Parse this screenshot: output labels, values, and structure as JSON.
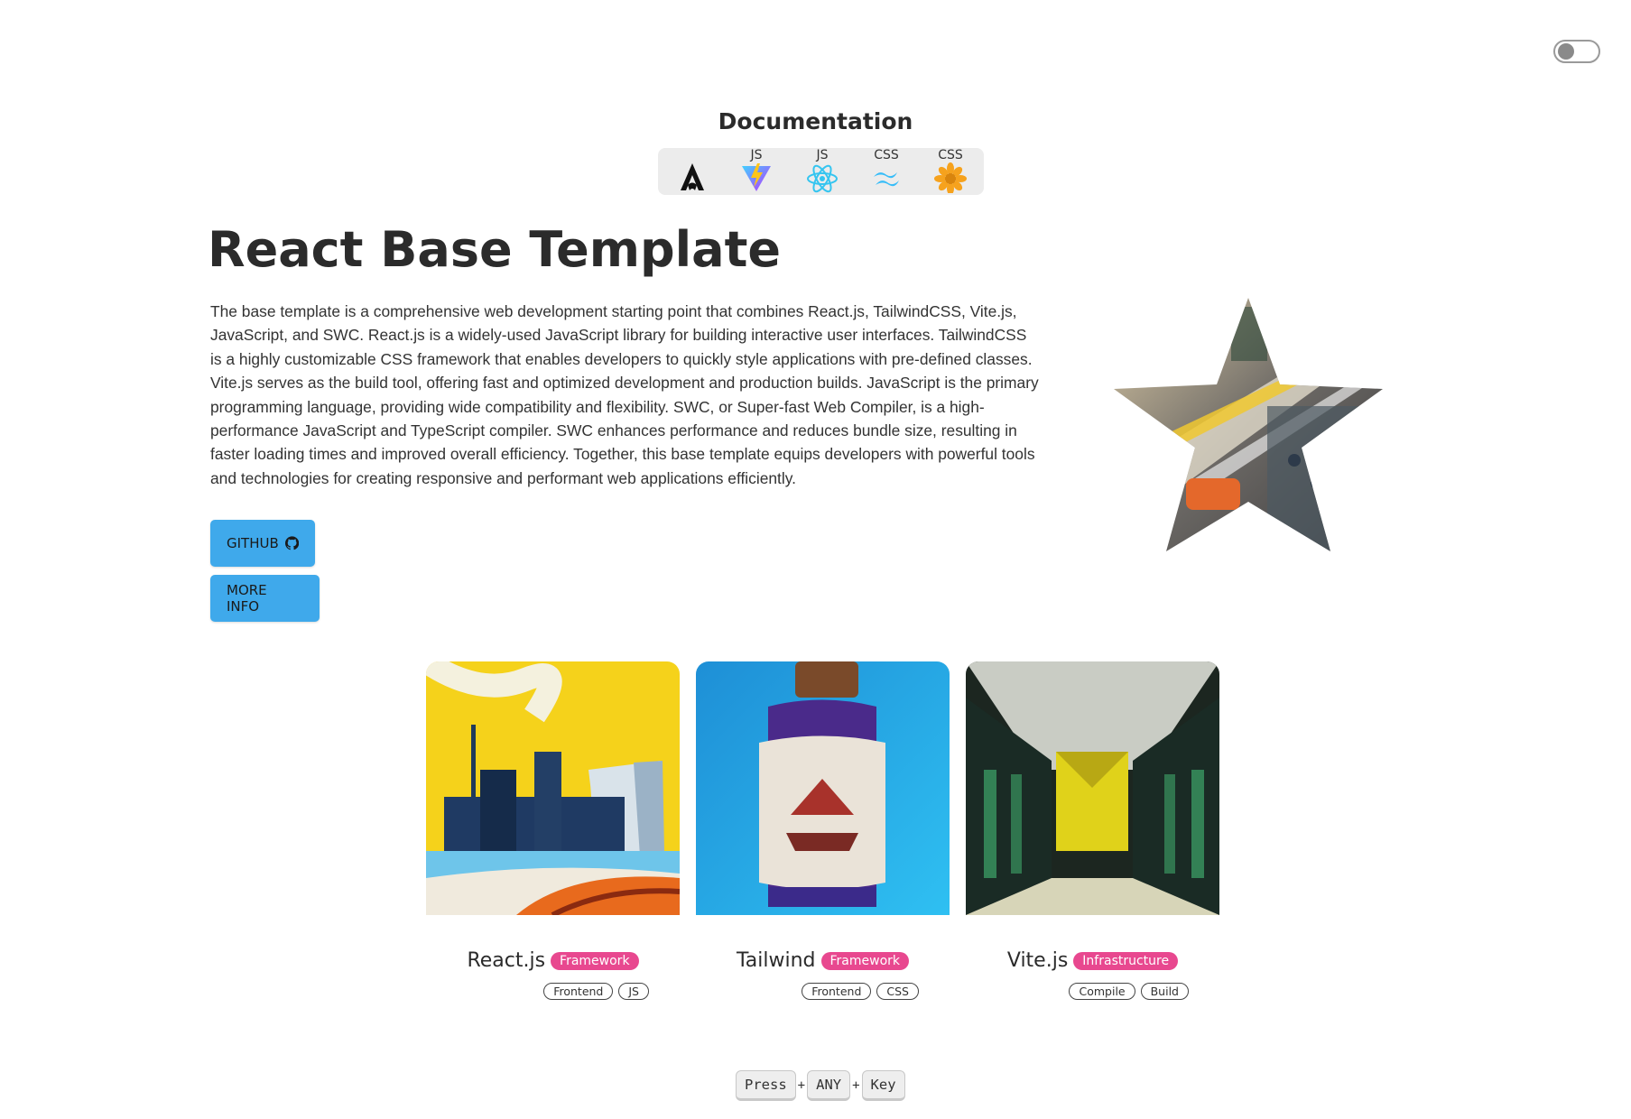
{
  "theme_toggle": {
    "label": "",
    "state": "off"
  },
  "docs": {
    "title": "Documentation",
    "items": [
      {
        "name": "astro-icon",
        "tag": ""
      },
      {
        "name": "vite-icon",
        "tag": "JS"
      },
      {
        "name": "react-icon",
        "tag": "JS"
      },
      {
        "name": "tailwind-icon",
        "tag": "CSS"
      },
      {
        "name": "daisyui-icon",
        "tag": "CSS"
      }
    ]
  },
  "hero": {
    "title": "React Base Template",
    "description": "The base template is a comprehensive web development starting point that combines React.js, TailwindCSS, Vite.js, JavaScript, and SWC. React.js is a widely-used JavaScript library for building interactive user interfaces. TailwindCSS is a highly customizable CSS framework that enables developers to quickly style applications with pre-defined classes. Vite.js serves as the build tool, offering fast and optimized development and production builds. JavaScript is the primary programming language, providing wide compatibility and flexibility. SWC, or Super-fast Web Compiler, is a high-performance JavaScript and TypeScript compiler. SWC enhances performance and reduces bundle size, resulting in faster loading times and improved overall efficiency. Together, this base template equips developers with powerful tools and technologies for creating responsive and performant web applications efficiently.",
    "github_label": "GITHUB",
    "github_icon": "github-icon",
    "more_info_label": "MORE INFO"
  },
  "cards": [
    {
      "title": "React.js",
      "badge": "Framework",
      "tags": [
        "Frontend",
        "JS"
      ]
    },
    {
      "title": "Tailwind",
      "badge": "Framework",
      "tags": [
        "Frontend",
        "CSS"
      ]
    },
    {
      "title": "Vite.js",
      "badge": "Infrastructure",
      "tags": [
        "Compile",
        "Build"
      ]
    }
  ],
  "shortcut": {
    "keys": [
      "Press",
      "ANY",
      "Key"
    ],
    "separator": "+"
  },
  "colors": {
    "primary_button": "#3fa9eb",
    "badge": "#e8488f",
    "text": "#2b2b2b"
  }
}
